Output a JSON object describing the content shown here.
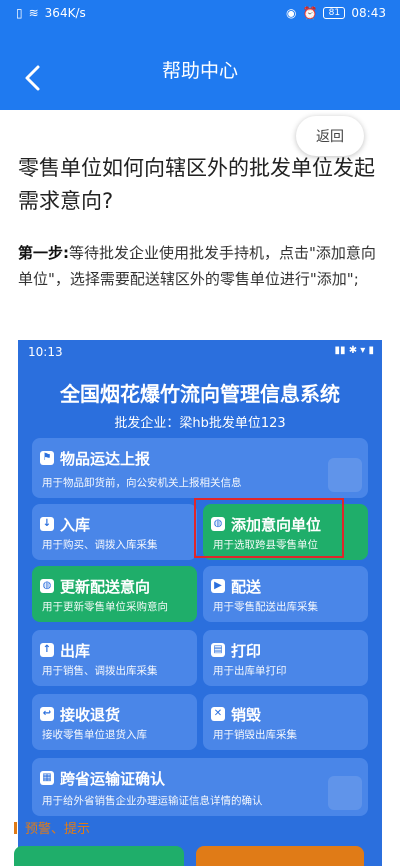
{
  "status_bar": {
    "speed": "364K/s",
    "battery": "81",
    "time": "08:43"
  },
  "header": {
    "title": "帮助中心"
  },
  "return_button": "返回",
  "question": "零售单位如何向辖区外的批发单位发起需求意向?",
  "step": {
    "label": "第一步:",
    "text": "等待批发企业使用批发手持机，点击\"添加意向单位\"，选择需要配送辖区外的零售单位进行\"添加\";"
  },
  "screenshot": {
    "time": "10:13",
    "title": "全国烟花爆竹流向管理信息系统",
    "subtitle": "批发企业：梁hb批发单位123",
    "cards": [
      {
        "name": "物品运达上报",
        "desc": "用于物品卸货前，向公安机关上报相关信息"
      },
      {
        "name": "入库",
        "desc": "用于购买、调拨入库采集"
      },
      {
        "name": "添加意向单位",
        "desc": "用于选取跨县零售单位"
      },
      {
        "name": "更新配送意向",
        "desc": "用于更新零售单位采购意向"
      },
      {
        "name": "配送",
        "desc": "用于零售配送出库采集"
      },
      {
        "name": "出库",
        "desc": "用于销售、调拨出库采集"
      },
      {
        "name": "打印",
        "desc": "用于出库单打印"
      },
      {
        "name": "接收退货",
        "desc": "接收零售单位退货入库"
      },
      {
        "name": "销毁",
        "desc": "用于销毁出库采集"
      },
      {
        "name": "跨省运输证确认",
        "desc": "用于给外省销售企业办理运输证信息详情的确认"
      }
    ],
    "alert_label": "预警、提示"
  },
  "colors": {
    "header_blue": "#1f7af0",
    "card_green": "#1fae6a",
    "highlight_red": "#e0262a",
    "alert_orange": "#e07b17"
  }
}
